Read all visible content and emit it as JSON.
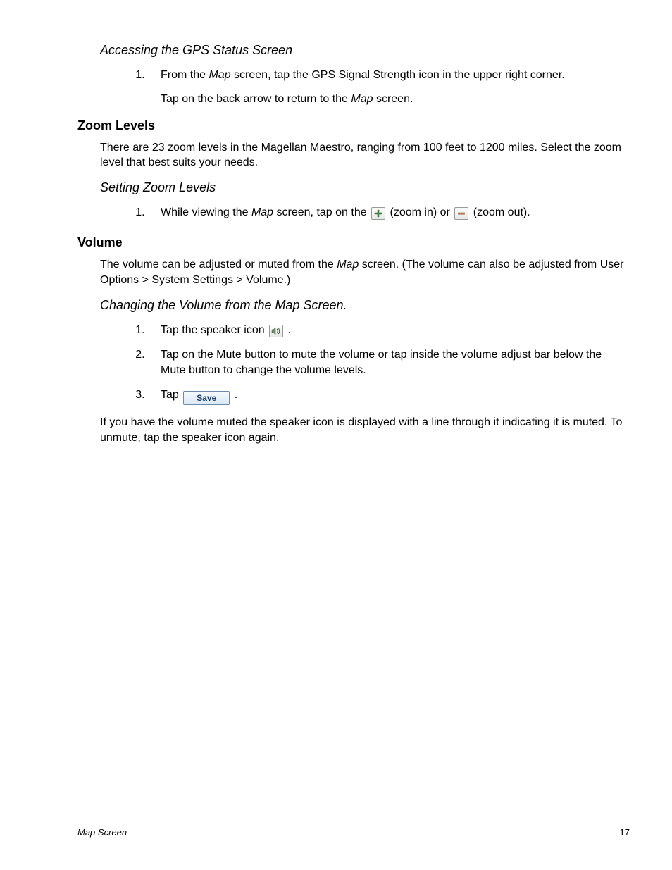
{
  "section1": {
    "heading": "Accessing the GPS Status Screen",
    "steps": [
      {
        "pre": "From the ",
        "em": "Map",
        "post": " screen, tap the GPS Signal Strength icon in the upper right corner."
      }
    ],
    "sub": {
      "pre": "Tap on the back arrow to return to the ",
      "em": "Map",
      "post": " screen."
    }
  },
  "section2": {
    "heading": "Zoom Levels",
    "body": "There are 23 zoom levels in the Magellan Maestro, ranging from 100 feet to 1200 miles. Select the zoom level that best suits your needs.",
    "sub_heading": "Setting Zoom Levels",
    "steps": [
      {
        "pre": "While viewing the ",
        "em": "Map",
        "mid": " screen, tap on the ",
        "after_in": " (zoom in) or ",
        "after_out": " (zoom out)."
      }
    ]
  },
  "section3": {
    "heading": "Volume",
    "body_pre": "The volume can be adjusted or muted from the ",
    "body_em": "Map",
    "body_post": " screen.  (The volume can also be adjusted from User Options > System Settings > Volume.)",
    "sub_heading": "Changing the Volume from the Map Screen.",
    "steps": [
      {
        "pre": "Tap the speaker icon ",
        "post": " ."
      },
      {
        "text": "Tap on the Mute button to mute the volume or tap inside the volume adjust bar below the Mute button to change the volume levels."
      },
      {
        "pre": "Tap ",
        "post": " ."
      }
    ],
    "save_label": "Save",
    "tail": "If you have the volume muted the speaker icon is displayed with a line through it indicating it is muted.  To unmute, tap the speaker icon again."
  },
  "footer": {
    "left": "Map Screen",
    "right": "17"
  }
}
